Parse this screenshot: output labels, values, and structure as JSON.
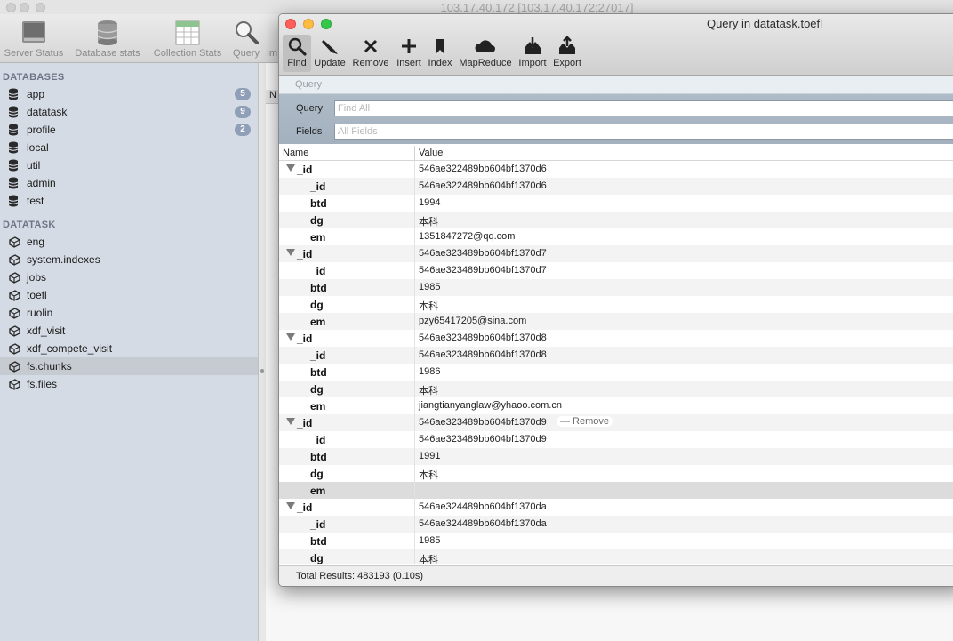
{
  "main_window": {
    "title": "103.17.40.172 [103.17.40.172:27017]",
    "toolbar": [
      {
        "label": "Server Status",
        "icon": "server-icon"
      },
      {
        "label": "Database stats",
        "icon": "database-stats-icon"
      },
      {
        "label": "Collection Stats",
        "icon": "collection-stats-icon"
      },
      {
        "label": "Query",
        "icon": "magnifier-icon"
      },
      {
        "label": "Im",
        "icon": "import-icon"
      }
    ],
    "header_col": "N"
  },
  "sidebar": {
    "databases_heading": "DATABASES",
    "databases": [
      {
        "label": "app",
        "count": "5"
      },
      {
        "label": "datatask",
        "count": "9"
      },
      {
        "label": "profile",
        "count": "2"
      },
      {
        "label": "local",
        "count": ""
      },
      {
        "label": "util",
        "count": ""
      },
      {
        "label": "admin",
        "count": ""
      },
      {
        "label": "test",
        "count": ""
      }
    ],
    "collections_heading": "DATATASK",
    "collections": [
      {
        "label": "eng"
      },
      {
        "label": "system.indexes"
      },
      {
        "label": "jobs"
      },
      {
        "label": "toefl"
      },
      {
        "label": "ruolin"
      },
      {
        "label": "xdf_visit"
      },
      {
        "label": "xdf_compete_visit"
      },
      {
        "label": "fs.chunks",
        "selected": true
      },
      {
        "label": "fs.files"
      }
    ]
  },
  "query_window": {
    "title": "Query in datatask.toefl",
    "toolbar": [
      {
        "label": "Find",
        "icon": "find-icon",
        "active": true
      },
      {
        "label": "Update",
        "icon": "update-icon"
      },
      {
        "label": "Remove",
        "icon": "remove-icon"
      },
      {
        "label": "Insert",
        "icon": "insert-icon"
      },
      {
        "label": "Index",
        "icon": "index-icon"
      },
      {
        "label": "MapReduce",
        "icon": "cloud-icon"
      },
      {
        "label": "Import",
        "icon": "import-icon"
      },
      {
        "label": "Export",
        "icon": "export-icon"
      }
    ],
    "tab_label": "Query",
    "form": {
      "query_label": "Query",
      "query_placeholder": "Find All",
      "fields_label": "Fields",
      "fields_placeholder": "All Fields"
    },
    "table": {
      "col_name": "Name",
      "col_value": "Value",
      "rows": [
        {
          "name": "_id",
          "value": "546ae322489bb604bf1370d6",
          "level": 0
        },
        {
          "name": "_id",
          "value": "546ae322489bb604bf1370d6",
          "level": 1
        },
        {
          "name": "btd",
          "value": "1994",
          "level": 1
        },
        {
          "name": "dg",
          "value": "本科",
          "level": 1
        },
        {
          "name": "em",
          "value": "1351847272@qq.com",
          "level": 1
        },
        {
          "name": "_id",
          "value": "546ae323489bb604bf1370d7",
          "level": 0
        },
        {
          "name": "_id",
          "value": "546ae323489bb604bf1370d7",
          "level": 1
        },
        {
          "name": "btd",
          "value": "1985",
          "level": 1
        },
        {
          "name": "dg",
          "value": "本科",
          "level": 1
        },
        {
          "name": "em",
          "value": "pzy65417205@sina.com",
          "level": 1
        },
        {
          "name": "_id",
          "value": "546ae323489bb604bf1370d8",
          "level": 0
        },
        {
          "name": "_id",
          "value": "546ae323489bb604bf1370d8",
          "level": 1
        },
        {
          "name": "btd",
          "value": "1986",
          "level": 1
        },
        {
          "name": "dg",
          "value": "本科",
          "level": 1
        },
        {
          "name": "em",
          "value": "jiangtianyanglaw@yhaoo.com.cn",
          "level": 1
        },
        {
          "name": "_id",
          "value": "546ae323489bb604bf1370d9",
          "level": 0,
          "hover_action": "— Remove"
        },
        {
          "name": "_id",
          "value": "546ae323489bb604bf1370d9",
          "level": 1
        },
        {
          "name": "btd",
          "value": "1991",
          "level": 1
        },
        {
          "name": "dg",
          "value": "本科",
          "level": 1
        },
        {
          "name": "em",
          "value": "",
          "level": 1,
          "highlight": true
        },
        {
          "name": "_id",
          "value": "546ae324489bb604bf1370da",
          "level": 0
        },
        {
          "name": "_id",
          "value": "546ae324489bb604bf1370da",
          "level": 1
        },
        {
          "name": "btd",
          "value": "1985",
          "level": 1
        },
        {
          "name": "dg",
          "value": "本科",
          "level": 1
        }
      ]
    },
    "status": "Total Results: 483193 (0.10s)"
  }
}
